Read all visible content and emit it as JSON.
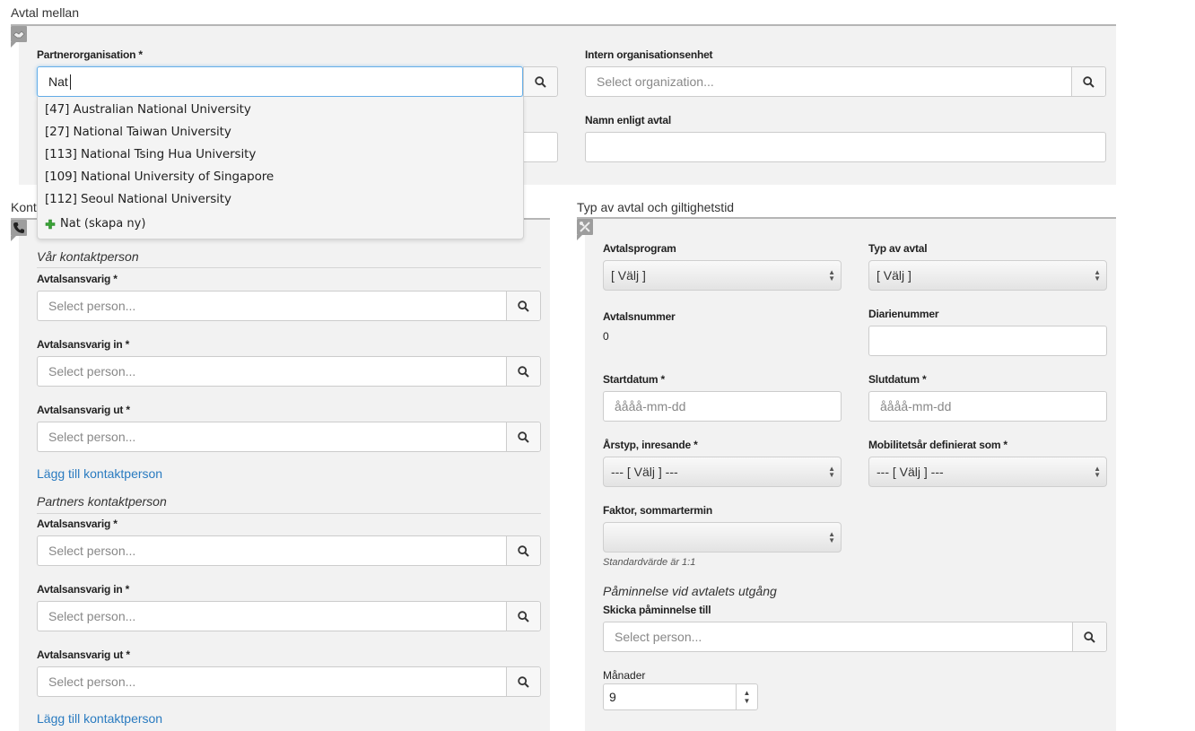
{
  "sections": {
    "agreement_between": {
      "title": "Avtal mellan"
    },
    "contacts": {
      "title": "Kontaktpersoner"
    },
    "type_validity": {
      "title": "Typ av avtal och giltighetstid"
    }
  },
  "partner": {
    "label": "Partnerorganisation *",
    "value": "Nat",
    "dropdown": [
      "[47] Australian National University",
      "[27] National Taiwan University",
      "[113] National Tsing Hua University",
      "[109] National University of Singapore",
      "[112] Seoul National University"
    ],
    "create_new": "Nat (skapa ny)"
  },
  "internal_unit": {
    "label": "Intern organisationsenhet",
    "placeholder": "Select organization..."
  },
  "name_per_agreement": {
    "label": "Namn enligt avtal",
    "value": ""
  },
  "our_contact": {
    "heading": "Vår kontaktperson",
    "fields": [
      {
        "label": "Avtalsansvarig *",
        "placeholder": "Select person..."
      },
      {
        "label": "Avtalsansvarig in *",
        "placeholder": "Select person..."
      },
      {
        "label": "Avtalsansvarig ut *",
        "placeholder": "Select person..."
      }
    ],
    "add_link": "Lägg till kontaktperson"
  },
  "partner_contact": {
    "heading": "Partners kontaktperson",
    "fields": [
      {
        "label": "Avtalsansvarig *",
        "placeholder": "Select person..."
      },
      {
        "label": "Avtalsansvarig in *",
        "placeholder": "Select person..."
      },
      {
        "label": "Avtalsansvarig ut *",
        "placeholder": "Select person..."
      }
    ],
    "add_link": "Lägg till kontaktperson"
  },
  "type": {
    "program": {
      "label": "Avtalsprogram",
      "selected": "[ Välj ]"
    },
    "agreement_type": {
      "label": "Typ av avtal",
      "selected": "[ Välj ]"
    },
    "number": {
      "label": "Avtalsnummer",
      "value": "0"
    },
    "diary": {
      "label": "Diarienummer",
      "value": ""
    },
    "start": {
      "label": "Startdatum *",
      "placeholder": "åååå-mm-dd"
    },
    "end": {
      "label": "Slutdatum *",
      "placeholder": "åååå-mm-dd"
    },
    "year_type": {
      "label": "Årstyp, inresande *",
      "selected": "--- [ Välj ] ---"
    },
    "mobility_year": {
      "label": "Mobilitetsår definierat som *",
      "selected": "--- [ Välj ] ---"
    },
    "summer_factor": {
      "label": "Faktor, sommartermin",
      "selected": "",
      "help": "Standardvärde är 1:1"
    },
    "reminder": {
      "heading": "Påminnelse vid avtalets utgång",
      "send_to": {
        "label": "Skicka påminnelse till",
        "placeholder": "Select person..."
      },
      "months": {
        "label": "Månader",
        "value": "9"
      }
    }
  },
  "colors": {
    "panel": "#f2f2f2",
    "link": "#2a7bc0",
    "focus": "#66afe9",
    "plus": "#3aa335"
  },
  "icons": [
    "handshake-icon",
    "phone-icon",
    "tools-icon",
    "search-icon",
    "plus-icon",
    "select-arrows-icon"
  ]
}
